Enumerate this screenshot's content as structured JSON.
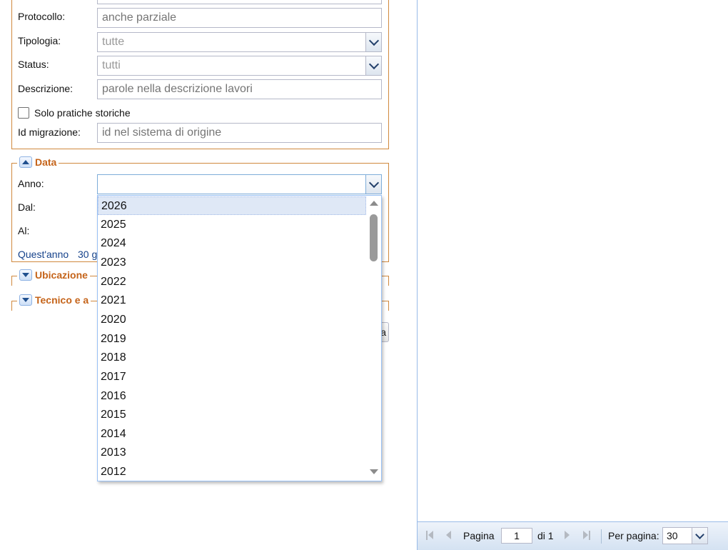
{
  "form": {
    "protocollo": {
      "label": "Protocollo:",
      "placeholder": "anche parziale"
    },
    "tipologia": {
      "label": "Tipologia:",
      "value": "tutte"
    },
    "status": {
      "label": "Status:",
      "value": "tutti"
    },
    "descrizione": {
      "label": "Descrizione:",
      "placeholder": "parole nella descrizione lavori"
    },
    "solo_storiche": {
      "label": "Solo pratiche storiche",
      "checked": false
    },
    "id_migrazione": {
      "label": "Id migrazione:",
      "placeholder": "id nel sistema di origine"
    }
  },
  "data_section": {
    "title": "Data",
    "anno_label": "Anno:",
    "anno_value": "",
    "dal_label": "Dal:",
    "al_label": "Al:",
    "quick_links": [
      "Quest'anno",
      "30 g"
    ]
  },
  "ubicazione_section": {
    "title": "Ubicazione"
  },
  "tecnico_section": {
    "title": "Tecnico e a"
  },
  "hidden_button_fragment": "a",
  "dropdown": {
    "items": [
      "2026",
      "2025",
      "2024",
      "2023",
      "2022",
      "2021",
      "2020",
      "2019",
      "2018",
      "2017",
      "2016",
      "2015",
      "2014",
      "2013",
      "2012"
    ],
    "selected_index": 0
  },
  "pager": {
    "page_label": "Pagina",
    "page_value": "1",
    "of_label": "di 1",
    "per_page_label": "Per pagina:",
    "per_page_value": "30"
  },
  "colors": {
    "accent": "#c5641a",
    "border": "#d0893e",
    "link": "#15428b"
  }
}
